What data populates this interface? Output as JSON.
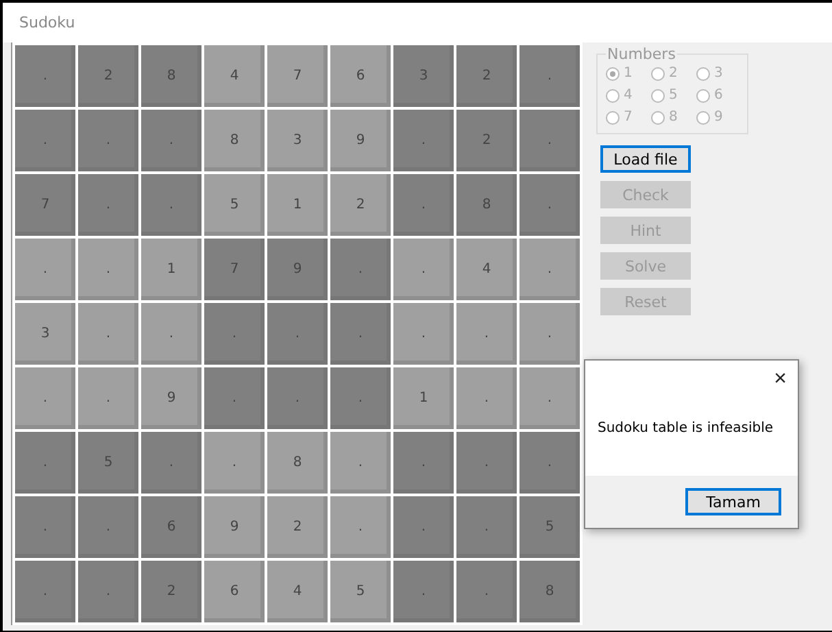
{
  "window": {
    "title": "Sudoku"
  },
  "grid": [
    [
      ".",
      "2",
      "8",
      "4",
      "7",
      "6",
      "3",
      "2",
      "."
    ],
    [
      ".",
      ".",
      ".",
      "8",
      "3",
      "9",
      ".",
      "2",
      "."
    ],
    [
      "7",
      ".",
      ".",
      "5",
      "1",
      "2",
      ".",
      "8",
      "."
    ],
    [
      ".",
      ".",
      "1",
      "7",
      "9",
      ".",
      ".",
      "4",
      "."
    ],
    [
      "3",
      ".",
      ".",
      ".",
      ".",
      ".",
      ".",
      ".",
      "."
    ],
    [
      ".",
      ".",
      "9",
      ".",
      ".",
      ".",
      "1",
      ".",
      "."
    ],
    [
      ".",
      "5",
      ".",
      ".",
      "8",
      ".",
      ".",
      ".",
      "."
    ],
    [
      ".",
      ".",
      "6",
      "9",
      "2",
      ".",
      ".",
      ".",
      "5"
    ],
    [
      ".",
      ".",
      "2",
      "6",
      "4",
      "5",
      ".",
      ".",
      "8"
    ]
  ],
  "numbers": {
    "title": "Numbers",
    "options": [
      {
        "label": "1",
        "selected": true,
        "disabled": true
      },
      {
        "label": "2",
        "selected": false,
        "disabled": true
      },
      {
        "label": "3",
        "selected": false,
        "disabled": true
      },
      {
        "label": "4",
        "selected": false,
        "disabled": true
      },
      {
        "label": "5",
        "selected": false,
        "disabled": true
      },
      {
        "label": "6",
        "selected": false,
        "disabled": true
      },
      {
        "label": "7",
        "selected": false,
        "disabled": true
      },
      {
        "label": "8",
        "selected": false,
        "disabled": true
      },
      {
        "label": "9",
        "selected": false,
        "disabled": true
      }
    ]
  },
  "buttons": [
    {
      "label": "Load file",
      "disabled": false,
      "focused": true
    },
    {
      "label": "Check",
      "disabled": true,
      "focused": false
    },
    {
      "label": "Hint",
      "disabled": true,
      "focused": false
    },
    {
      "label": "Solve",
      "disabled": true,
      "focused": false
    },
    {
      "label": "Reset",
      "disabled": true,
      "focused": false
    }
  ],
  "dialog": {
    "close": "×",
    "message": "Sudoku table is infeasible",
    "button": "Tamam"
  }
}
